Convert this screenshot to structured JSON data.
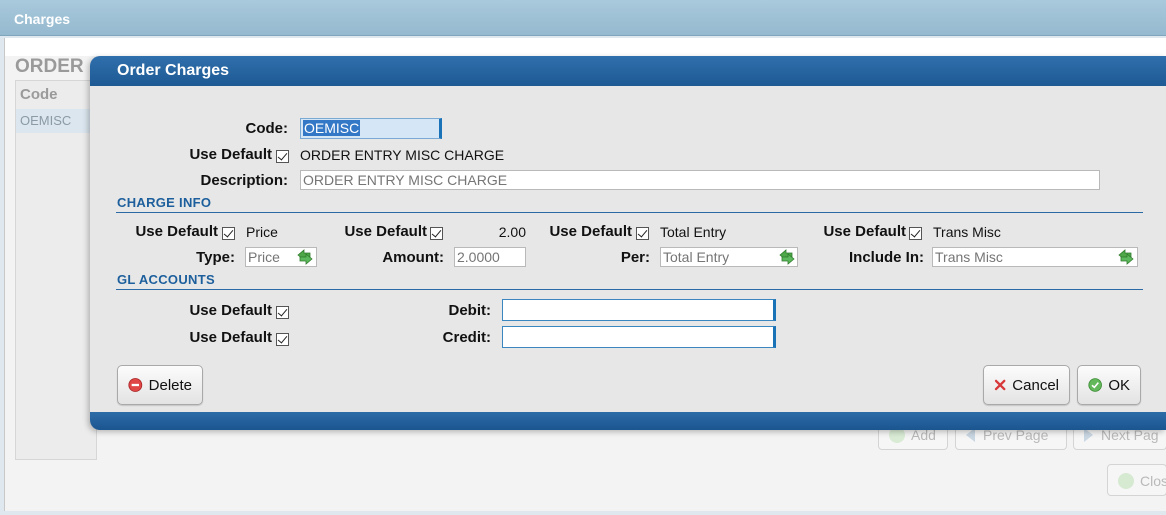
{
  "background": {
    "window_title": "Charges",
    "heading": "ORDER",
    "list_header": "Code",
    "list_row": "OEMISC",
    "buttons": {
      "add": "Add",
      "prev": "Prev Page",
      "next": "Next Pag",
      "close": "Clos"
    }
  },
  "dialog": {
    "title": "Order Charges",
    "code_label": "Code:",
    "code_value": "OEMISC",
    "use_default_label": "Use Default",
    "default_description": "ORDER ENTRY MISC CHARGE",
    "description_label": "Description:",
    "description_placeholder": "ORDER ENTRY MISC CHARGE",
    "charge_info_title": "CHARGE INFO",
    "charge_info": {
      "type_default": "Price",
      "amount_default": "2.00",
      "per_default": "Total Entry",
      "include_default": "Trans Misc",
      "type_label": "Type:",
      "type_value": "Price",
      "amount_label": "Amount:",
      "amount_value": "2.0000",
      "per_label": "Per:",
      "per_value": "Total Entry",
      "include_label": "Include In:",
      "include_value": "Trans Misc"
    },
    "gl_title": "GL ACCOUNTS",
    "gl": {
      "debit_label": "Debit:",
      "credit_label": "Credit:",
      "debit_value": "",
      "credit_value": ""
    },
    "buttons": {
      "delete": "Delete",
      "cancel": "Cancel",
      "ok": "OK"
    }
  },
  "colors": {
    "accent": "#1e5a94",
    "section": "#1d5f9c"
  }
}
